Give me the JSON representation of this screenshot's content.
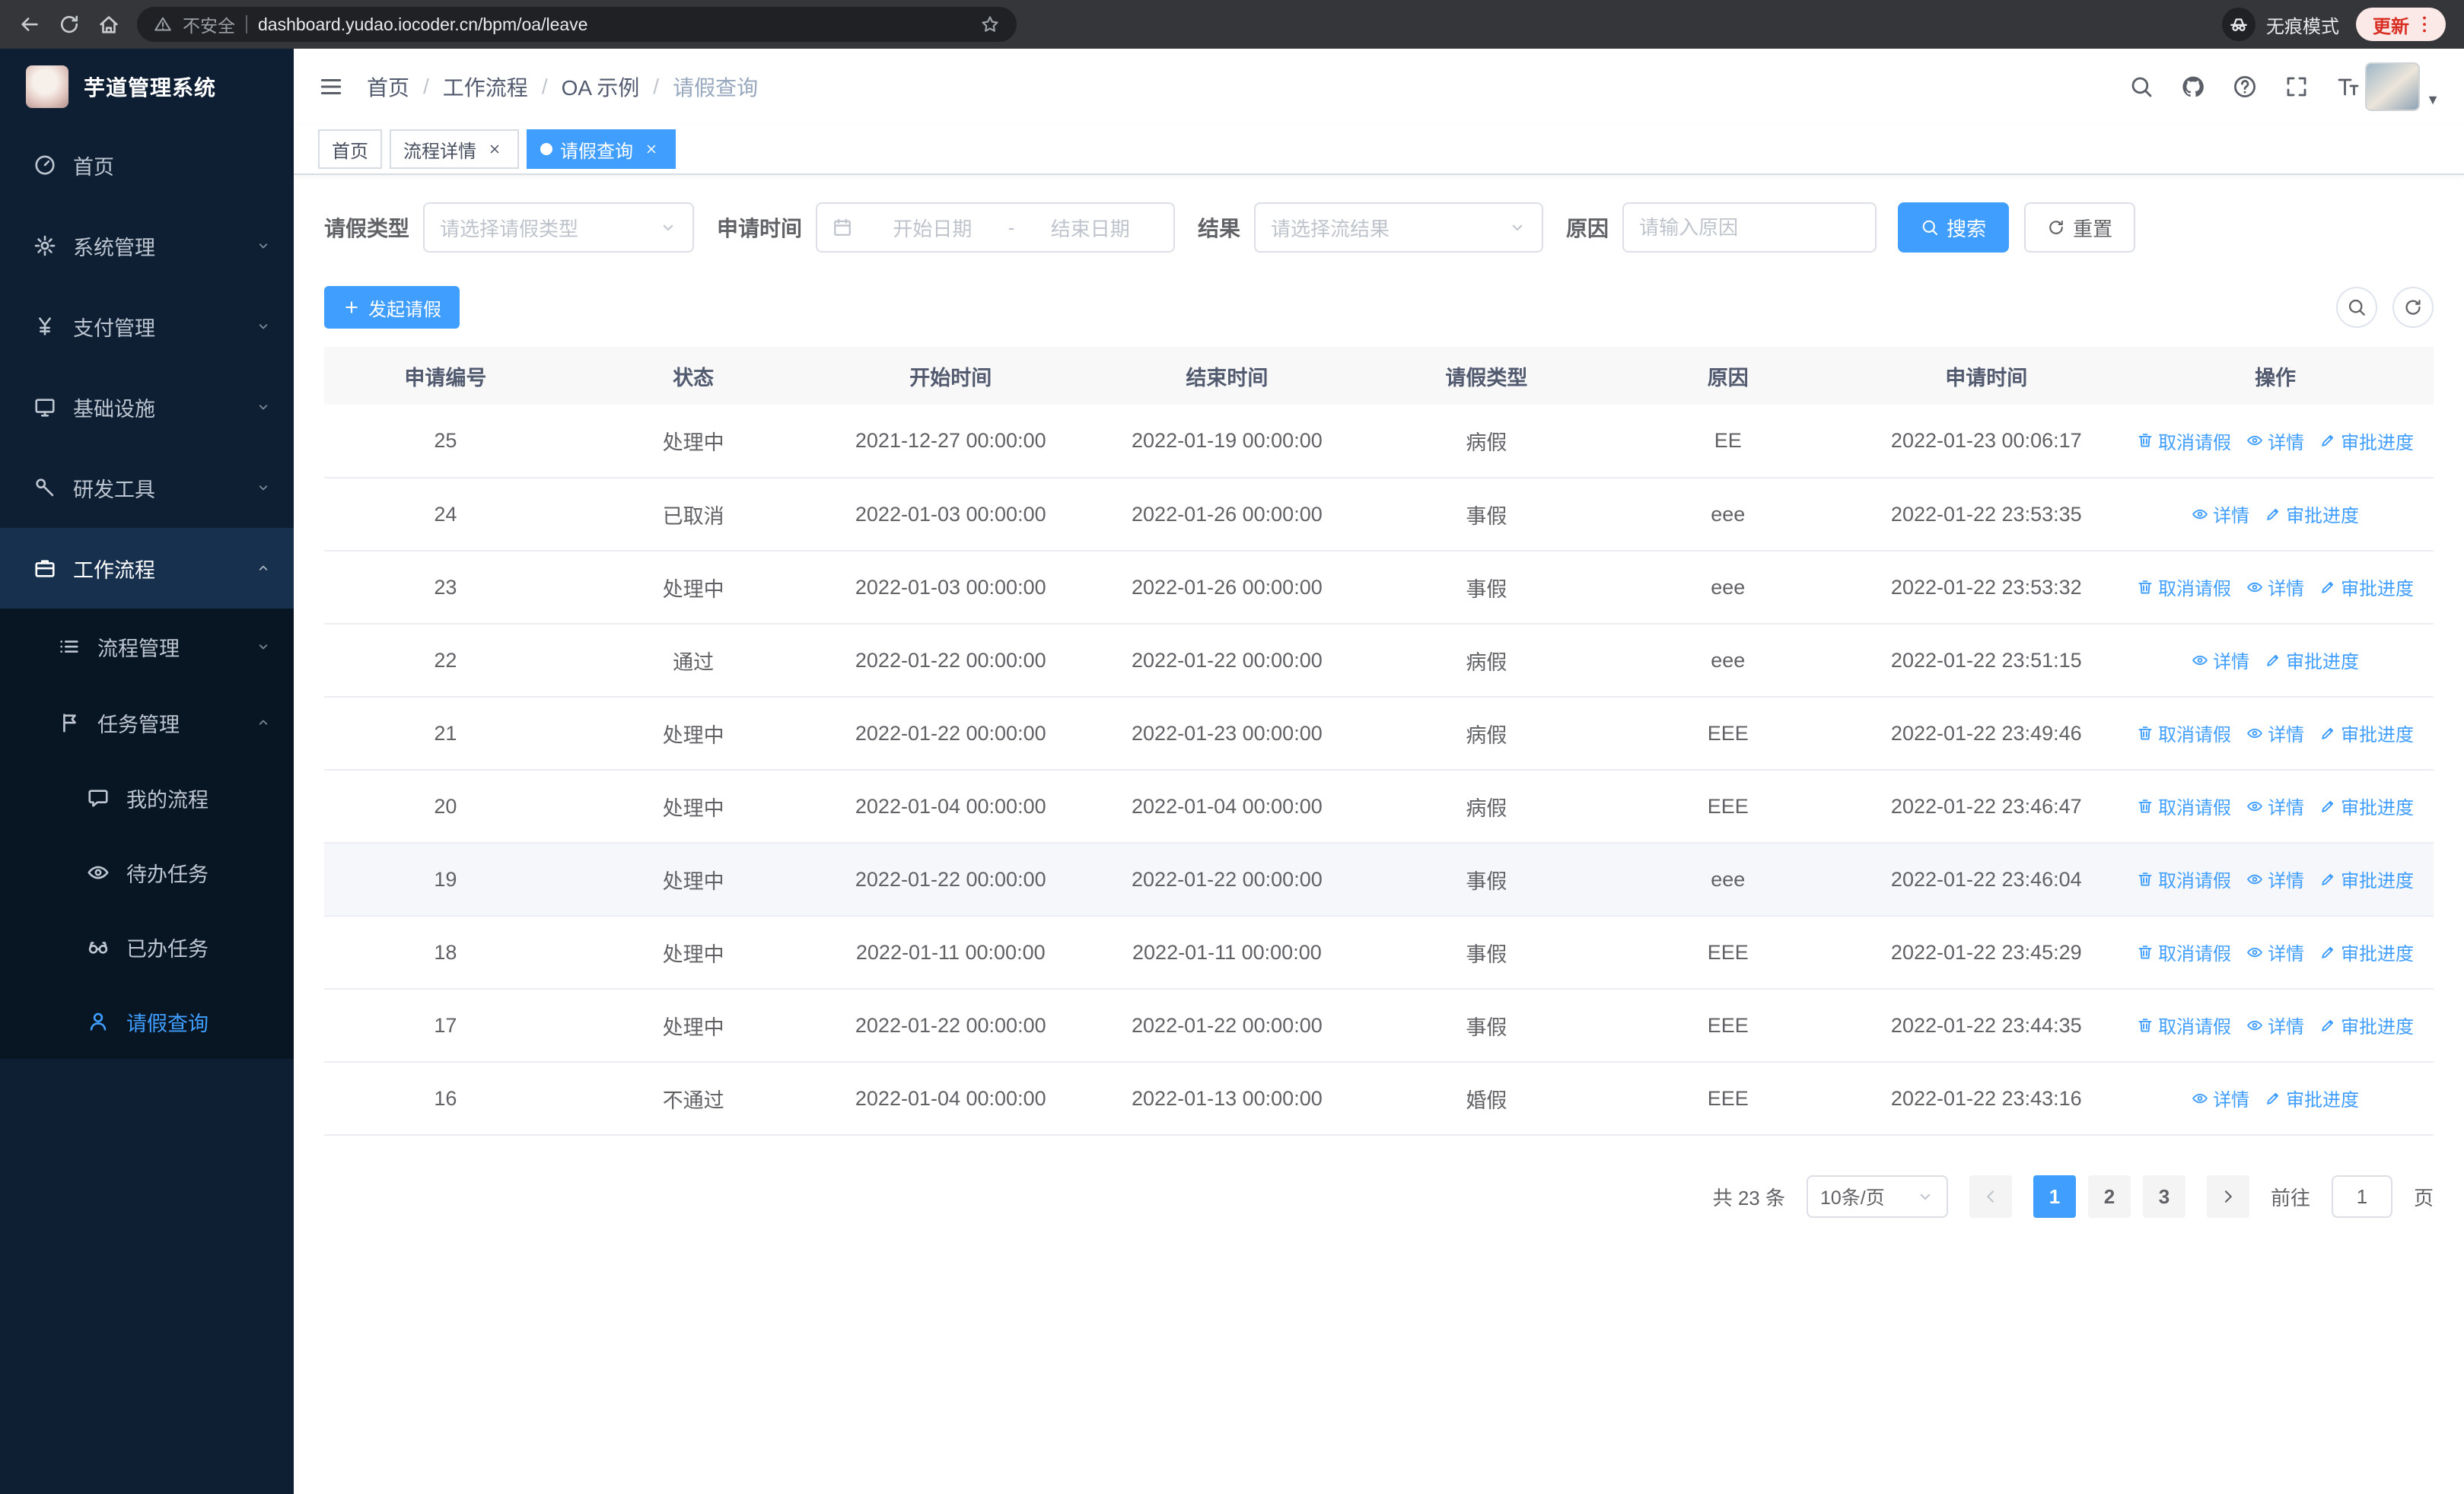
{
  "browser": {
    "security": "不安全",
    "url": "dashboard.yudao.iocoder.cn/bpm/oa/leave",
    "incognito": "无痕模式",
    "update": "更新"
  },
  "sidebar": {
    "title": "芋道管理系统",
    "items": [
      {
        "label": "首页",
        "icon": "dashboard-icon",
        "arrow": ""
      },
      {
        "label": "系统管理",
        "icon": "gear-icon",
        "arrow": "down"
      },
      {
        "label": "支付管理",
        "icon": "payment-icon",
        "arrow": "down"
      },
      {
        "label": "基础设施",
        "icon": "infrastructure-icon",
        "arrow": "down"
      },
      {
        "label": "研发工具",
        "icon": "devtools-icon",
        "arrow": "down"
      },
      {
        "label": "工作流程",
        "icon": "workflow-icon",
        "arrow": "up",
        "active": true
      }
    ],
    "workflow_children": [
      {
        "label": "流程管理",
        "icon": "process-icon",
        "arrow": "down"
      },
      {
        "label": "任务管理",
        "icon": "task-icon",
        "arrow": "up"
      }
    ],
    "task_children": [
      {
        "label": "我的流程",
        "icon": "my-process-icon"
      },
      {
        "label": "待办任务",
        "icon": "todo-icon"
      },
      {
        "label": "已办任务",
        "icon": "done-icon"
      },
      {
        "label": "请假查询",
        "icon": "leave-icon",
        "active": true
      }
    ]
  },
  "header": {
    "breadcrumb": [
      "首页",
      "工作流程",
      "OA 示例",
      "请假查询"
    ],
    "icons": [
      "search-icon",
      "github-icon",
      "question-icon",
      "fullscreen-icon",
      "fontsize-icon"
    ]
  },
  "tabs": [
    {
      "label": "首页",
      "closable": false,
      "active": false
    },
    {
      "label": "流程详情",
      "closable": true,
      "active": false
    },
    {
      "label": "请假查询",
      "closable": true,
      "active": true
    }
  ],
  "filters": {
    "leave_type_label": "请假类型",
    "leave_type_placeholder": "请选择请假类型",
    "apply_time_label": "申请时间",
    "date_start_placeholder": "开始日期",
    "date_separator": "-",
    "date_end_placeholder": "结束日期",
    "result_label": "结果",
    "result_placeholder": "请选择流结果",
    "reason_label": "原因",
    "reason_placeholder": "请输入原因",
    "search_button": "搜索",
    "reset_button": "重置"
  },
  "toolbar": {
    "create_button": "发起请假"
  },
  "table": {
    "columns": [
      "申请编号",
      "状态",
      "开始时间",
      "结束时间",
      "请假类型",
      "原因",
      "申请时间",
      "操作"
    ],
    "rows": [
      {
        "id": "25",
        "status": "处理中",
        "start": "2021-12-27 00:00:00",
        "end": "2022-01-19 00:00:00",
        "type": "病假",
        "reason": "EE",
        "applied": "2022-01-23 00:06:17",
        "actions": [
          {
            "label": "取消请假",
            "icon": "cancel-icon"
          },
          {
            "label": "详情",
            "icon": "eye-icon"
          },
          {
            "label": "审批进度",
            "icon": "edit-icon"
          }
        ]
      },
      {
        "id": "24",
        "status": "已取消",
        "start": "2022-01-03 00:00:00",
        "end": "2022-01-26 00:00:00",
        "type": "事假",
        "reason": "eee",
        "applied": "2022-01-22 23:53:35",
        "actions": [
          {
            "label": "详情",
            "icon": "eye-icon"
          },
          {
            "label": "审批进度",
            "icon": "edit-icon"
          }
        ]
      },
      {
        "id": "23",
        "status": "处理中",
        "start": "2022-01-03 00:00:00",
        "end": "2022-01-26 00:00:00",
        "type": "事假",
        "reason": "eee",
        "applied": "2022-01-22 23:53:32",
        "actions": [
          {
            "label": "取消请假",
            "icon": "cancel-icon"
          },
          {
            "label": "详情",
            "icon": "eye-icon"
          },
          {
            "label": "审批进度",
            "icon": "edit-icon"
          }
        ]
      },
      {
        "id": "22",
        "status": "通过",
        "start": "2022-01-22 00:00:00",
        "end": "2022-01-22 00:00:00",
        "type": "病假",
        "reason": "eee",
        "applied": "2022-01-22 23:51:15",
        "actions": [
          {
            "label": "详情",
            "icon": "eye-icon"
          },
          {
            "label": "审批进度",
            "icon": "edit-icon"
          }
        ]
      },
      {
        "id": "21",
        "status": "处理中",
        "start": "2022-01-22 00:00:00",
        "end": "2022-01-23 00:00:00",
        "type": "病假",
        "reason": "EEE",
        "applied": "2022-01-22 23:49:46",
        "actions": [
          {
            "label": "取消请假",
            "icon": "cancel-icon"
          },
          {
            "label": "详情",
            "icon": "eye-icon"
          },
          {
            "label": "审批进度",
            "icon": "edit-icon"
          }
        ]
      },
      {
        "id": "20",
        "status": "处理中",
        "start": "2022-01-04 00:00:00",
        "end": "2022-01-04 00:00:00",
        "type": "病假",
        "reason": "EEE",
        "applied": "2022-01-22 23:46:47",
        "actions": [
          {
            "label": "取消请假",
            "icon": "cancel-icon"
          },
          {
            "label": "详情",
            "icon": "eye-icon"
          },
          {
            "label": "审批进度",
            "icon": "edit-icon"
          }
        ]
      },
      {
        "id": "19",
        "status": "处理中",
        "start": "2022-01-22 00:00:00",
        "end": "2022-01-22 00:00:00",
        "type": "事假",
        "reason": "eee",
        "applied": "2022-01-22 23:46:04",
        "highlight": true,
        "actions": [
          {
            "label": "取消请假",
            "icon": "cancel-icon"
          },
          {
            "label": "详情",
            "icon": "eye-icon"
          },
          {
            "label": "审批进度",
            "icon": "edit-icon"
          }
        ]
      },
      {
        "id": "18",
        "status": "处理中",
        "start": "2022-01-11 00:00:00",
        "end": "2022-01-11 00:00:00",
        "type": "事假",
        "reason": "EEE",
        "applied": "2022-01-22 23:45:29",
        "actions": [
          {
            "label": "取消请假",
            "icon": "cancel-icon"
          },
          {
            "label": "详情",
            "icon": "eye-icon"
          },
          {
            "label": "审批进度",
            "icon": "edit-icon"
          }
        ]
      },
      {
        "id": "17",
        "status": "处理中",
        "start": "2022-01-22 00:00:00",
        "end": "2022-01-22 00:00:00",
        "type": "事假",
        "reason": "EEE",
        "applied": "2022-01-22 23:44:35",
        "actions": [
          {
            "label": "取消请假",
            "icon": "cancel-icon"
          },
          {
            "label": "详情",
            "icon": "eye-icon"
          },
          {
            "label": "审批进度",
            "icon": "edit-icon"
          }
        ]
      },
      {
        "id": "16",
        "status": "不通过",
        "start": "2022-01-04 00:00:00",
        "end": "2022-01-13 00:00:00",
        "type": "婚假",
        "reason": "EEE",
        "applied": "2022-01-22 23:43:16",
        "actions": [
          {
            "label": "详情",
            "icon": "eye-icon"
          },
          {
            "label": "审批进度",
            "icon": "edit-icon"
          }
        ]
      }
    ]
  },
  "pagination": {
    "total": "共 23 条",
    "page_size": "10条/页",
    "pages": [
      "1",
      "2",
      "3"
    ],
    "active_page": "1",
    "goto_label": "前往",
    "goto_value": "1",
    "goto_suffix": "页"
  }
}
